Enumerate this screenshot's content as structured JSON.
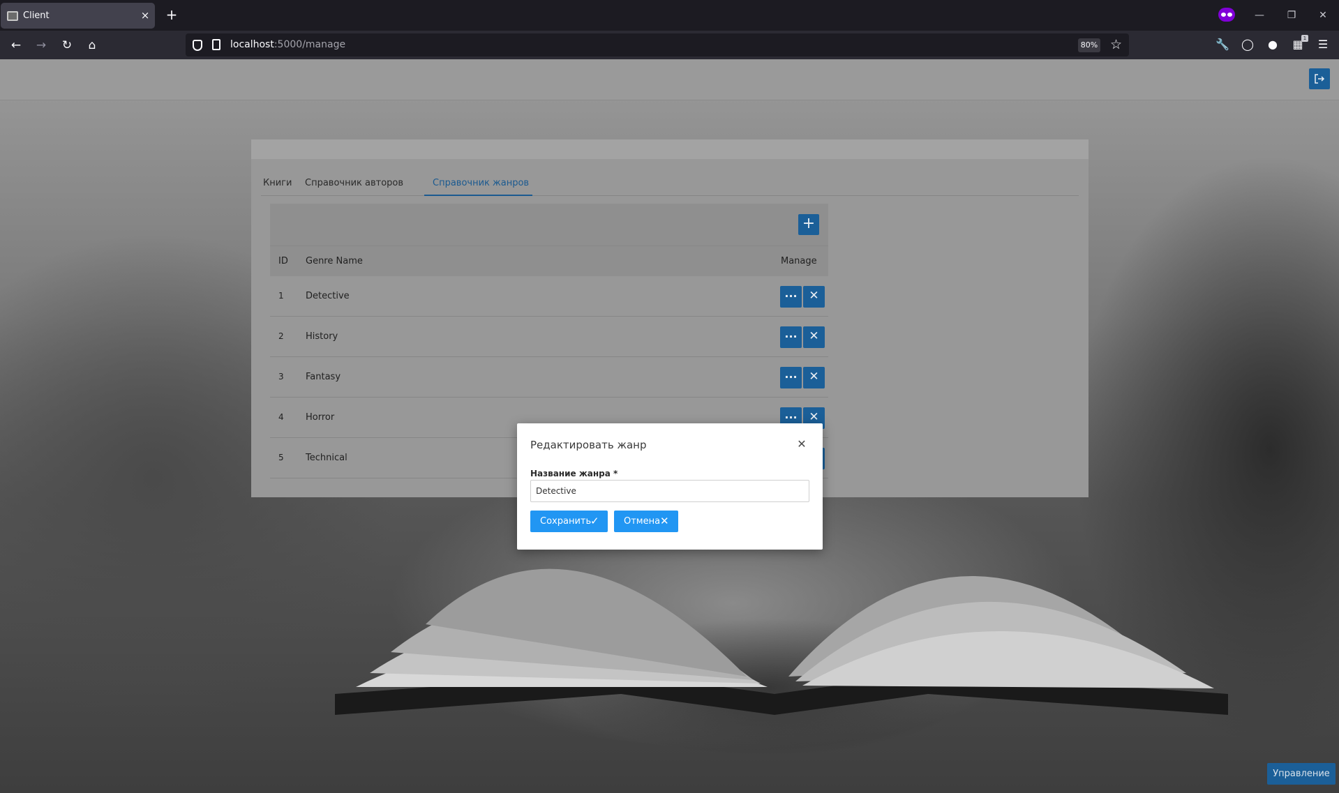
{
  "browser": {
    "tab_title": "Client",
    "tab_close": "×",
    "new_tab": "+",
    "url_host": "localhost",
    "url_rest": ":5000/manage",
    "zoom": "80%",
    "icons": [
      "back-icon",
      "forward-icon",
      "reload-icon",
      "home-icon",
      "shield-icon",
      "page-icon",
      "star-icon",
      "wrench-icon",
      "pocket-icon",
      "globe-icon",
      "extensions-icon",
      "menu-icon",
      "private-browsing-icon"
    ],
    "extension_badge": "1"
  },
  "app": {
    "tabs": [
      {
        "label": "Книги"
      },
      {
        "label": "Справочник авторов"
      },
      {
        "label": "Справочник жанров"
      }
    ],
    "active_tab": 2,
    "grid": {
      "add_label": "+",
      "columns": [
        "ID",
        "Genre Name",
        "Manage"
      ],
      "rows": [
        {
          "id": "1",
          "name": "Detective"
        },
        {
          "id": "2",
          "name": "History"
        },
        {
          "id": "3",
          "name": "Fantasy"
        },
        {
          "id": "4",
          "name": "Horror"
        },
        {
          "id": "5",
          "name": "Technical"
        }
      ],
      "edit_glyph": "···",
      "delete_glyph": "✕"
    },
    "manage_button": "Управление",
    "accent_color": "#1b5f98"
  },
  "modal": {
    "title": "Редактировать жанр",
    "close_glyph": "✕",
    "field_label": "Название жанра *",
    "field_value": "Detective",
    "save_label": "Сохранить",
    "save_icon": "✓",
    "cancel_label": "Отмена",
    "cancel_icon": "✕",
    "button_color": "#2196f3"
  }
}
